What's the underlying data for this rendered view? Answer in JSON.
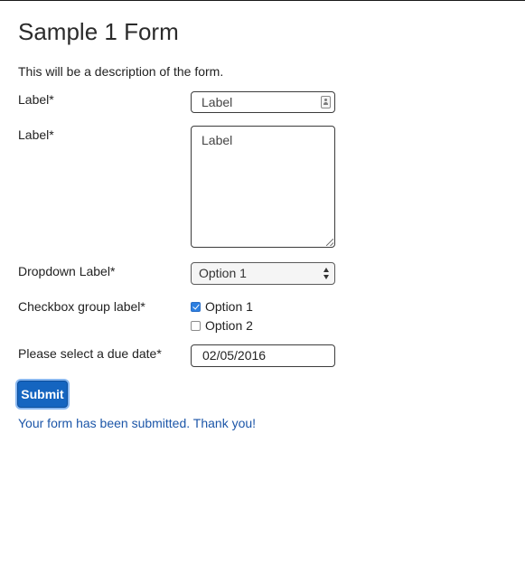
{
  "form": {
    "title": "Sample 1 Form",
    "description": "This will be a description of the form."
  },
  "fields": {
    "text": {
      "label": "Label*",
      "value": "Label"
    },
    "textarea": {
      "label": "Label*",
      "value": "Label"
    },
    "dropdown": {
      "label": "Dropdown Label*",
      "selected": "Option 1"
    },
    "checkbox_group": {
      "label": "Checkbox group label*",
      "options": [
        {
          "label": "Option 1",
          "checked": true
        },
        {
          "label": "Option 2",
          "checked": false
        }
      ]
    },
    "due_date": {
      "label": "Please select a due date*",
      "value": "02/05/2016"
    }
  },
  "actions": {
    "submit_label": "Submit"
  },
  "status": {
    "message": "Your form has been submitted. Thank you!"
  },
  "colors": {
    "submit_button": "#1565c0",
    "success_text": "#1c56a8",
    "checkbox_checked": "#2d7fe0"
  },
  "icons": {
    "text_input": "contact-card-icon",
    "dropdown": "select-arrows-icon",
    "textarea": "resize-grip-icon"
  }
}
